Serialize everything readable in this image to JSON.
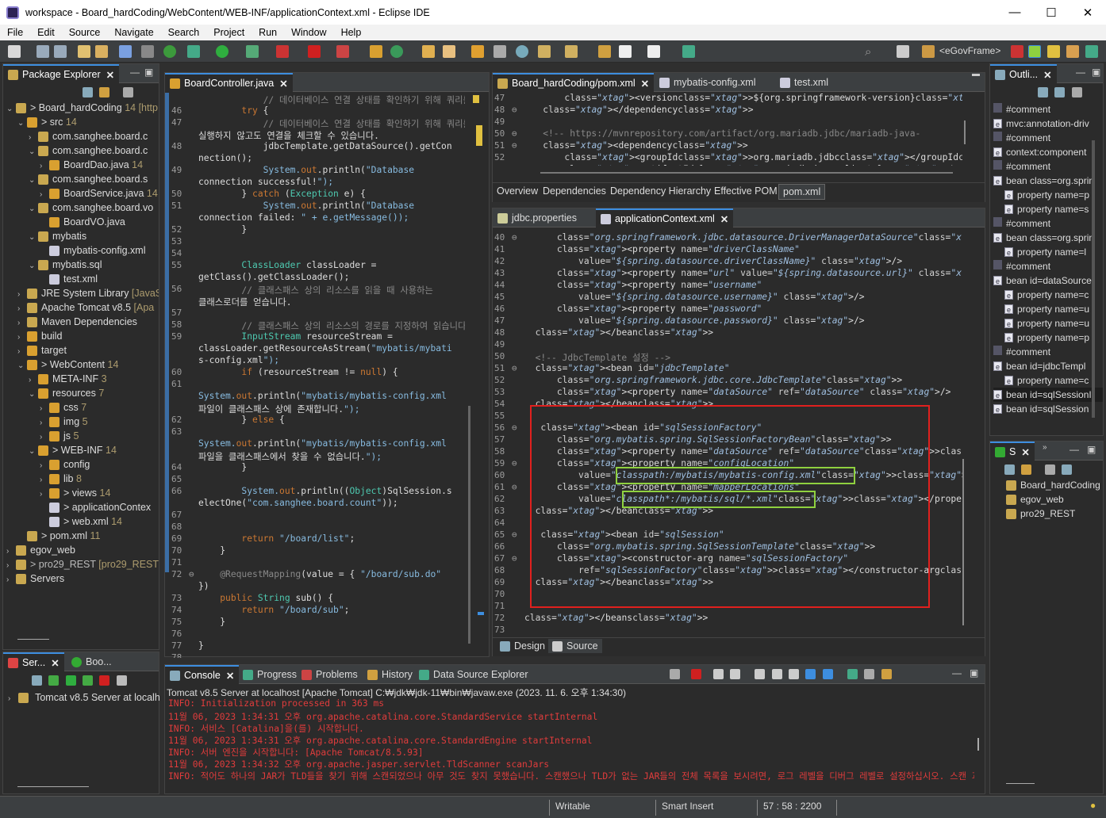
{
  "window": {
    "title": "workspace - Board_hardCoding/WebContent/WEB-INF/applicationContext.xml - Eclipse IDE",
    "min": "—",
    "max": "☐",
    "close": "✕"
  },
  "menu": [
    "File",
    "Edit",
    "Source",
    "Navigate",
    "Search",
    "Project",
    "Run",
    "Window",
    "Help"
  ],
  "toolbar": {
    "perspective": "<eGovFrame>"
  },
  "package_explorer": {
    "title": "Package Explorer",
    "items": [
      {
        "label": "Board_hardCoding",
        "dec": "14 [http"
      },
      {
        "label": "src",
        "dec": "14"
      },
      {
        "label": "com.sanghee.board.c",
        "dec": ""
      },
      {
        "label": "com.sanghee.board.c",
        "dec": ""
      },
      {
        "label": "BoardDao.java",
        "dec": "14"
      },
      {
        "label": "com.sanghee.board.s",
        "dec": ""
      },
      {
        "label": "BoardService.java",
        "dec": "14"
      },
      {
        "label": "com.sanghee.board.vo",
        "dec": ""
      },
      {
        "label": "BoardVO.java",
        "dec": ""
      },
      {
        "label": "mybatis",
        "dec": ""
      },
      {
        "label": "mybatis-config.xml",
        "dec": ""
      },
      {
        "label": "mybatis.sql",
        "dec": ""
      },
      {
        "label": "test.xml",
        "dec": ""
      },
      {
        "label": "JRE System Library",
        "dec": "[JavaSE"
      },
      {
        "label": "Apache Tomcat v8.5",
        "dec": "[Apa"
      },
      {
        "label": "Maven Dependencies",
        "dec": ""
      },
      {
        "label": "build",
        "dec": ""
      },
      {
        "label": "target",
        "dec": ""
      },
      {
        "label": "WebContent",
        "dec": "14"
      },
      {
        "label": "META-INF",
        "dec": "3"
      },
      {
        "label": "resources",
        "dec": "7"
      },
      {
        "label": "css",
        "dec": "7"
      },
      {
        "label": "img",
        "dec": "5"
      },
      {
        "label": "js",
        "dec": "5"
      },
      {
        "label": "WEB-INF",
        "dec": "14"
      },
      {
        "label": "config",
        "dec": ""
      },
      {
        "label": "lib",
        "dec": "8"
      },
      {
        "label": "views",
        "dec": "14"
      },
      {
        "label": "applicationContex",
        "dec": ""
      },
      {
        "label": "web.xml",
        "dec": "14"
      },
      {
        "label": "pom.xml",
        "dec": "11"
      },
      {
        "label": "egov_web",
        "dec": ""
      },
      {
        "label": "pro29_REST",
        "dec": "[pro29_REST r"
      },
      {
        "label": "Servers",
        "dec": ""
      }
    ]
  },
  "servers_panel": {
    "tab1": "Ser...",
    "tab2": "Boo...",
    "server": "Tomcat v8.5 Server at localh"
  },
  "java_editor": {
    "tab": "BoardController.java",
    "lines": [
      {
        "n": "",
        "t": "            // 데이터베이스 연결 상태를 확인하기 위해 쿼리를"
      },
      {
        "n": "46",
        "t": "        try {"
      },
      {
        "n": "47",
        "t": "            // 데이터베이스 연결 상태를 확인하기 위해 쿼리를"
      },
      {
        "n": "",
        "t": "실행하지 않고도 연결을 체크할 수 있습니다."
      },
      {
        "n": "48",
        "t": "            jdbcTemplate.getDataSource().getCon"
      },
      {
        "n": "",
        "t": "nection();"
      },
      {
        "n": "49",
        "t": "            System.out.println(\"Database"
      },
      {
        "n": "",
        "t": "connection successful!\");"
      },
      {
        "n": "50",
        "t": "        } catch (Exception e) {"
      },
      {
        "n": "51",
        "t": "            System.out.println(\"Database"
      },
      {
        "n": "",
        "t": "connection failed: \" + e.getMessage());"
      },
      {
        "n": "52",
        "t": "        }"
      },
      {
        "n": "53",
        "t": ""
      },
      {
        "n": "54",
        "t": ""
      },
      {
        "n": "55",
        "t": "        ClassLoader classLoader ="
      },
      {
        "n": "",
        "t": "getClass().getClassLoader();"
      },
      {
        "n": "56",
        "t": "        // 클래스패스 상의 리소스를 읽을 때 사용하는"
      },
      {
        "n": "",
        "t": "클래스로더를 얻습니다."
      },
      {
        "n": "57",
        "t": ""
      },
      {
        "n": "58",
        "t": "        // 클래스패스 상의 리소스의 경로를 지정하여 읽습니다."
      },
      {
        "n": "59",
        "t": "        InputStream resourceStream ="
      },
      {
        "n": "",
        "t": "classLoader.getResourceAsStream(\"mybatis/mybati"
      },
      {
        "n": "",
        "t": "s-config.xml\");"
      },
      {
        "n": "60",
        "t": "        if (resourceStream != null) {"
      },
      {
        "n": "61",
        "t": ""
      },
      {
        "n": "",
        "t": "System.out.println(\"mybatis/mybatis-config.xml"
      },
      {
        "n": "",
        "t": "파일이 클래스패스 상에 존재합니다.\");"
      },
      {
        "n": "62",
        "t": "        } else {"
      },
      {
        "n": "63",
        "t": ""
      },
      {
        "n": "",
        "t": "System.out.println(\"mybatis/mybatis-config.xml"
      },
      {
        "n": "",
        "t": "파일을 클래스패스에서 찾을 수 없습니다.\");"
      },
      {
        "n": "64",
        "t": "        }"
      },
      {
        "n": "65",
        "t": ""
      },
      {
        "n": "66",
        "t": "        System.out.println((Object)SqlSession.s"
      },
      {
        "n": "",
        "t": "electOne(\"com.sanghee.board.count\"));"
      },
      {
        "n": "67",
        "t": ""
      },
      {
        "n": "68",
        "t": ""
      },
      {
        "n": "69",
        "t": "        return \"/board/list\";"
      },
      {
        "n": "70",
        "t": "    }"
      },
      {
        "n": "71",
        "t": ""
      },
      {
        "n": "72",
        "t": "    @RequestMapping(value = { \"/board/sub.do\""
      },
      {
        "n": "",
        "t": "})"
      },
      {
        "n": "73",
        "t": "    public String sub() {"
      },
      {
        "n": "74",
        "t": "        return \"/board/sub\";"
      },
      {
        "n": "75",
        "t": "    }"
      },
      {
        "n": "76",
        "t": ""
      },
      {
        "n": "77",
        "t": "}"
      },
      {
        "n": "78",
        "t": ""
      }
    ]
  },
  "pom_editor": {
    "tabs": [
      "Board_hardCoding/pom.xml",
      "mybatis-config.xml",
      "test.xml"
    ],
    "lines": [
      {
        "n": "47",
        "t": "        <version>${org.springframework-version}</version>"
      },
      {
        "n": "48",
        "t": "    </dependency>"
      },
      {
        "n": "49",
        "t": ""
      },
      {
        "n": "50",
        "t": "    <!-- https://mvnrepository.com/artifact/org.mariadb.jdbc/mariadb-java-"
      },
      {
        "n": "51",
        "t": "    <dependency>"
      },
      {
        "n": "52",
        "t": "        <groupId>org.mariadb.jdbc</groupId>"
      },
      {
        "n": "53",
        "t": "        <artifactId>mariadb-java-client</artifactId>"
      }
    ],
    "bottom_tabs": [
      "Overview",
      "Dependencies",
      "Dependency Hierarchy",
      "Effective POM",
      "pom.xml"
    ]
  },
  "xml_editor": {
    "tabs": [
      "jdbc.properties",
      "applicationContext.xml"
    ],
    "lines": [
      {
        "n": "40",
        "t": "      class=\"org.springframework.jdbc.datasource.DriverManagerDataSource\">"
      },
      {
        "n": "41",
        "t": "      <property name=\"driverClassName\""
      },
      {
        "n": "42",
        "t": "          value=\"${spring.datasource.driverClassName}\" />"
      },
      {
        "n": "43",
        "t": "      <property name=\"url\" value=\"${spring.datasource.url}\" />"
      },
      {
        "n": "44",
        "t": "      <property name=\"username\""
      },
      {
        "n": "45",
        "t": "          value=\"${spring.datasource.username}\" />"
      },
      {
        "n": "46",
        "t": "      <property name=\"password\""
      },
      {
        "n": "47",
        "t": "          value=\"${spring.datasource.password}\" />"
      },
      {
        "n": "48",
        "t": "  </bean>"
      },
      {
        "n": "49",
        "t": ""
      },
      {
        "n": "50",
        "t": "  <!-- JdbcTemplate 설정 -->"
      },
      {
        "n": "51",
        "t": "  <bean id=\"jdbcTemplate\""
      },
      {
        "n": "52",
        "t": "      class=\"org.springframework.jdbc.core.JdbcTemplate\">"
      },
      {
        "n": "53",
        "t": "      <property name=\"dataSource\" ref=\"dataSource\" />"
      },
      {
        "n": "54",
        "t": "  </bean>"
      },
      {
        "n": "55",
        "t": ""
      },
      {
        "n": "56",
        "t": "   <bean id=\"sqlSessionFactory\""
      },
      {
        "n": "57",
        "t": "      class=\"org.mybatis.spring.SqlSessionFactoryBean\">"
      },
      {
        "n": "58",
        "t": "      <property name=\"dataSource\" ref=\"dataSource\"></property>"
      },
      {
        "n": "59",
        "t": "      <property name=\"configLocation\""
      },
      {
        "n": "60",
        "t": "          value=\"classpath:/mybatis/mybatis-config.xml\"></property>"
      },
      {
        "n": "61",
        "t": "      <property name=\"mapperLocations\""
      },
      {
        "n": "62",
        "t": "          value=\"classpath*:/mybatis/sql/*.xml\"></property>"
      },
      {
        "n": "63",
        "t": "  </bean>"
      },
      {
        "n": "64",
        "t": ""
      },
      {
        "n": "65",
        "t": "   <bean id=\"sqlSession\""
      },
      {
        "n": "66",
        "t": "      class=\"org.mybatis.spring.SqlSessionTemplate\">"
      },
      {
        "n": "67",
        "t": "      <constructor-arg name=\"sqlSessionFactory\""
      },
      {
        "n": "68",
        "t": "          ref=\"sqlSessionFactory\"></constructor-arg>"
      },
      {
        "n": "69",
        "t": "  </bean>"
      },
      {
        "n": "70",
        "t": ""
      },
      {
        "n": "71",
        "t": ""
      },
      {
        "n": "72",
        "t": "</beans>"
      },
      {
        "n": "73",
        "t": ""
      }
    ],
    "bottom_tabs": [
      "Design",
      "Source"
    ]
  },
  "outline": {
    "title": "Outli...",
    "items": [
      {
        "type": "hash",
        "label": "#comment"
      },
      {
        "type": "e",
        "label": "mvc:annotation-driv"
      },
      {
        "type": "hash",
        "label": "#comment"
      },
      {
        "type": "e",
        "label": "context:component"
      },
      {
        "type": "hash",
        "label": "#comment"
      },
      {
        "type": "e",
        "label": "bean class=org.sprin"
      },
      {
        "type": "e2",
        "label": "property name=p"
      },
      {
        "type": "e2",
        "label": "property name=s"
      },
      {
        "type": "hash",
        "label": "#comment"
      },
      {
        "type": "e",
        "label": "bean class=org.sprin"
      },
      {
        "type": "e2",
        "label": "property name=l"
      },
      {
        "type": "hash",
        "label": "#comment"
      },
      {
        "type": "e",
        "label": "bean id=dataSource"
      },
      {
        "type": "e2",
        "label": "property name=c"
      },
      {
        "type": "e2",
        "label": "property name=u"
      },
      {
        "type": "e2",
        "label": "property name=u"
      },
      {
        "type": "e2",
        "label": "property name=p"
      },
      {
        "type": "hash",
        "label": "#comment"
      },
      {
        "type": "e",
        "label": "bean id=jdbcTempl"
      },
      {
        "type": "e2",
        "label": "property name=c"
      },
      {
        "type": "e",
        "label": "bean id=sqlSessionI"
      },
      {
        "type": "e",
        "label": "bean id=sqlSession"
      }
    ]
  },
  "servers_small": {
    "title": "S",
    "items": [
      "Board_hardCoding",
      "egov_web",
      "pro29_REST"
    ]
  },
  "console": {
    "tabs": [
      "Console",
      "Progress",
      "Problems",
      "History",
      "Data Source Explorer"
    ],
    "header": "Tomcat v8.5 Server at localhost [Apache Tomcat] C:₩jdk₩jdk-11₩bin₩javaw.exe  (2023. 11. 6. 오후 1:34:30)",
    "lines": [
      "INFO: Initialization processed in 363 ms",
      "11월 06, 2023 1:34:31 오후 org.apache.catalina.core.StandardService startInternal",
      "INFO: 서비스 [Catalina]을(를) 시작합니다.",
      "11월 06, 2023 1:34:31 오후 org.apache.catalina.core.StandardEngine startInternal",
      "INFO: 서버 엔진을 시작합니다: [Apache Tomcat/8.5.93]",
      "11월 06, 2023 1:34:32 오후 org.apache.jasper.servlet.TldScanner scanJars",
      "INFO: 적어도 하나의 JAR가 TLD들을 찾기 위해 스캔되었으나 아무 것도 찾지 못했습니다. 스캔했으나 TLD가 없는 JAR들의 전체 목록을 보시려면, 로그 레벨을 디버그 레벨로 설정하십시오. 스캔 과정에서 불필요"
    ]
  },
  "status": {
    "writable": "Writable",
    "insert": "Smart Insert",
    "position": "57 : 58 : 2200"
  },
  "colors": {
    "highlight_red": "#e0201e",
    "highlight_green": "#8fd13f",
    "accent": "#3d8ee0"
  }
}
